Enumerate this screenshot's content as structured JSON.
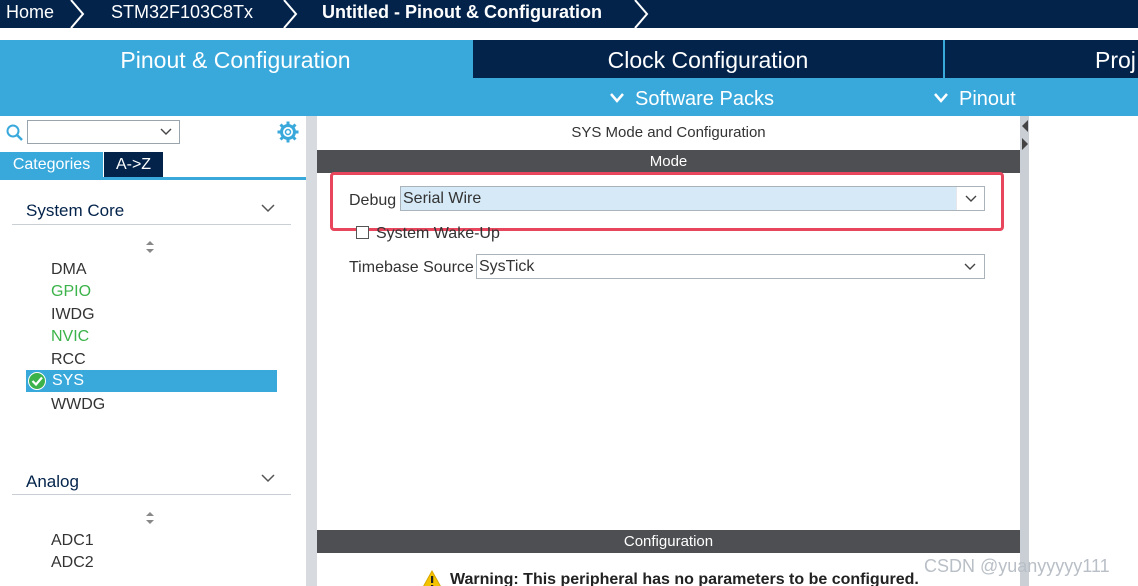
{
  "breadcrumb": {
    "home": "Home",
    "chip": "STM32F103C8Tx",
    "project": "Untitled - Pinout & Configuration"
  },
  "tabs": {
    "pinout": "Pinout & Configuration",
    "clock": "Clock Configuration",
    "project": "Proj"
  },
  "subbar": {
    "software_packs": "Software Packs",
    "pinout": "Pinout"
  },
  "left": {
    "search": {
      "value": ""
    },
    "categories_tab": "Categories",
    "az_tab": "A->Z",
    "system_core": {
      "title": "System Core",
      "items": [
        "DMA",
        "GPIO",
        "IWDG",
        "NVIC",
        "RCC",
        "SYS",
        "WWDG"
      ]
    },
    "analog": {
      "title": "Analog",
      "items": [
        "ADC1",
        "ADC2"
      ]
    }
  },
  "right": {
    "title": "SYS Mode and Configuration",
    "mode_header": "Mode",
    "debug_label": "Debug",
    "debug_value": "Serial Wire",
    "wakeup_label": "System Wake-Up",
    "timebase_label": "Timebase Source",
    "timebase_value": "SysTick",
    "config_header": "Configuration",
    "warning": "Warning: This peripheral has no parameters to be configured."
  },
  "watermark": "CSDN @yuanyyyyy111",
  "colors": {
    "navy": "#03234b",
    "accent_blue": "#39a9dc",
    "green": "#3cb34a",
    "highlight_red": "#e8465c",
    "section_gray": "#4e4f52"
  }
}
